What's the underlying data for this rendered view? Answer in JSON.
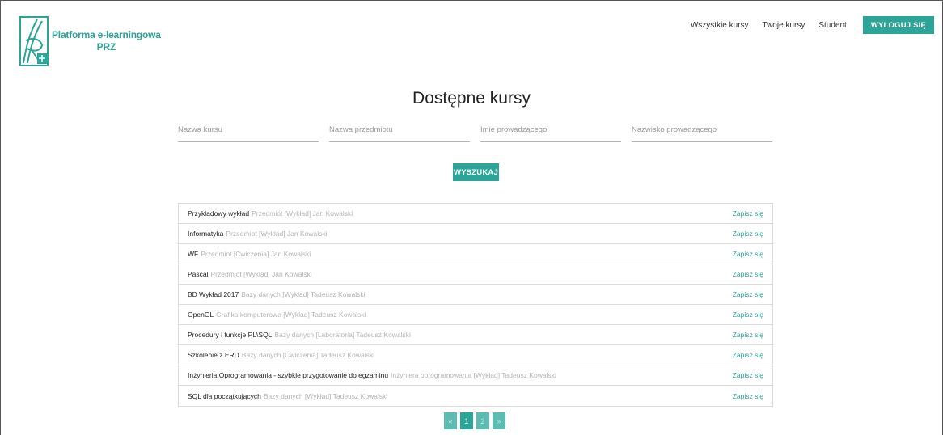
{
  "header": {
    "logo_line1": "Platforma e-learningowa",
    "logo_line2": "PRZ",
    "nav": {
      "all_courses": "Wszystkie kursy",
      "my_courses": "Twoje kursy",
      "user": "Student",
      "logout": "WYLOGUJ SIĘ"
    }
  },
  "main": {
    "title": "Dostępne kursy",
    "search": {
      "course_name": {
        "placeholder": "Nazwa kursu",
        "value": ""
      },
      "subject_name": {
        "placeholder": "Nazwa przedmiotu",
        "value": ""
      },
      "teacher_first_name": {
        "placeholder": "Imię prowadzącego",
        "value": ""
      },
      "teacher_last_name": {
        "placeholder": "Nazwisko prowadzącego",
        "value": ""
      },
      "button": "WYSZUKAJ"
    },
    "enroll_label": "Zapisz się",
    "courses": [
      {
        "name": "Przykładowy wykład",
        "meta": "Przedmiot [Wykład] Jan Kowalski"
      },
      {
        "name": "Informatyka",
        "meta": "Przedmiot [Wykład] Jan Kowalski"
      },
      {
        "name": "WF",
        "meta": "Przedmiot [Ćwiczenia] Jan Kowalski"
      },
      {
        "name": "Pascal",
        "meta": "Przedmiot [Wykład] Jan Kowalski"
      },
      {
        "name": "BD Wykład 2017",
        "meta": "Bazy danych [Wykład] Tadeusz Kowalski"
      },
      {
        "name": "OpenGL",
        "meta": "Grafika komputerowa [Wykład] Tadeusz Kowalski"
      },
      {
        "name": "Procedury i funkcje PL\\SQL",
        "meta": "Bazy danych [Laboratoria] Tadeusz Kowalski"
      },
      {
        "name": "Szkolenie z ERD",
        "meta": "Bazy danych [Ćwiczenia] Tadeusz Kowalski"
      },
      {
        "name": "Inżynieria Oprogramowania - szybkie przygotowanie do egzaminu",
        "meta": "Inżyniera oprogramowania [Wykład] Tadeusz Kowalski"
      },
      {
        "name": "SQL dla początkujących",
        "meta": "Bazy danych [Wykład] Tadeusz Kowalski"
      }
    ],
    "pagination": {
      "prev": "«",
      "pages": [
        "1",
        "2"
      ],
      "current": "1",
      "next": "»"
    }
  },
  "colors": {
    "accent": "#2aa597",
    "accent_dim": "#5cbcb1",
    "muted_text": "#b4b4b4",
    "border": "#dcdcdc"
  },
  "icons": {
    "logo": "prz-logo-icon"
  }
}
